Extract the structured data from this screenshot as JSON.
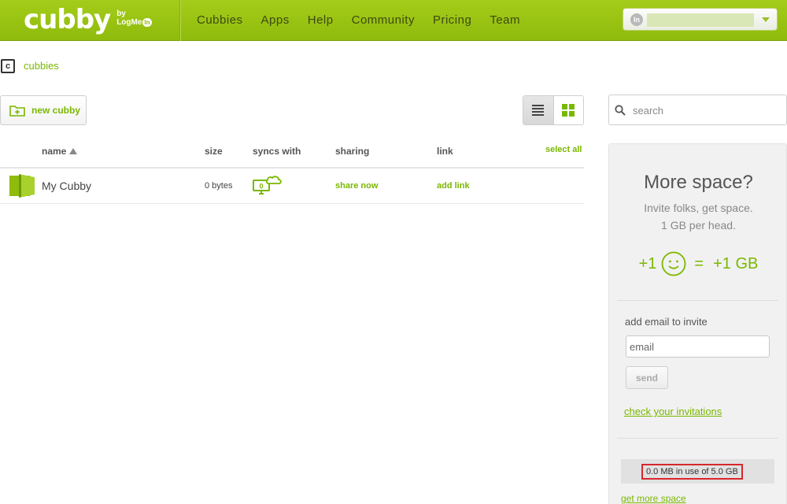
{
  "header": {
    "logo_text": "cubby",
    "logo_by": "by",
    "logo_brand": "LogMe",
    "logo_brand_badge": "In",
    "nav": [
      {
        "label": "Cubbies"
      },
      {
        "label": "Apps"
      },
      {
        "label": "Help"
      },
      {
        "label": "Community"
      },
      {
        "label": "Pricing"
      },
      {
        "label": "Team"
      }
    ],
    "account": {
      "avatar_text": "In"
    }
  },
  "breadcrumb": {
    "icon_letter": "c",
    "label": "cubbies"
  },
  "toolbar": {
    "new_cubby_label": "new cubby"
  },
  "table": {
    "columns": {
      "name": "name",
      "size": "size",
      "syncs_with": "syncs with",
      "sharing": "sharing",
      "link": "link",
      "select_all": "select all"
    },
    "sort": {
      "column": "name",
      "direction": "ascending"
    },
    "rows": [
      {
        "name": "My Cubby",
        "size": "0 bytes",
        "syncs_count": "0",
        "sharing": "share now",
        "link": "add link"
      }
    ]
  },
  "search": {
    "placeholder": "search"
  },
  "promo": {
    "title": "More space?",
    "subtitle_line1": "Invite folks, get space.",
    "subtitle_line2": "1 GB per head.",
    "formula_left": "+1",
    "formula_eq": "=",
    "formula_right": "+1 GB",
    "invite_label": "add email to invite",
    "email_placeholder": "email",
    "send_label": "send",
    "check_invitations": "check your invitations",
    "usage_text": "0.0 MB in use of 5.0 GB",
    "usage_fraction": 0.0,
    "get_more_space": "get more space"
  },
  "colors": {
    "brand_green": "#8fbb0c",
    "link_green": "#7ab800",
    "highlight_red": "#d9262c"
  }
}
